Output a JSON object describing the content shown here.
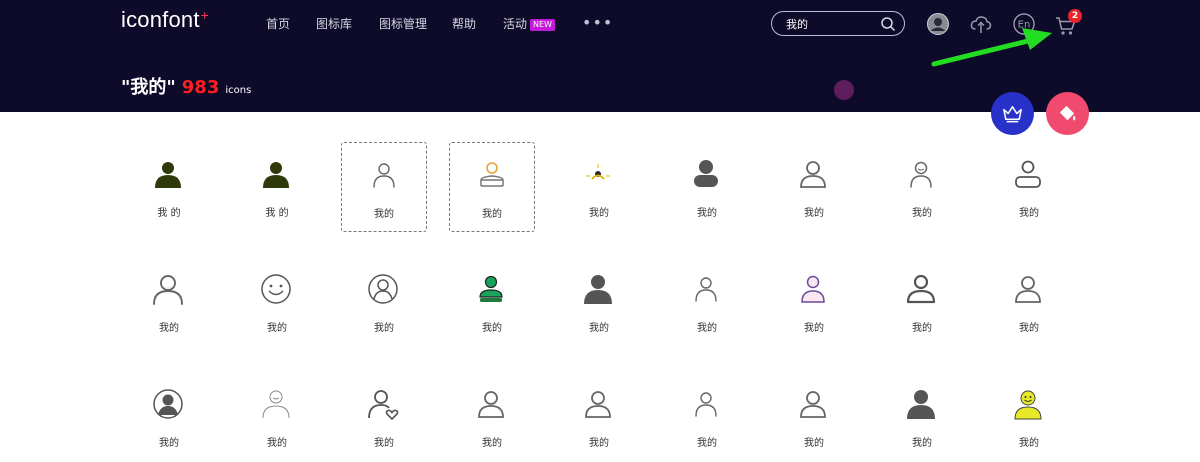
{
  "header": {
    "logo": "iconfont",
    "logo_mark": "+",
    "nav": [
      {
        "label": "首页"
      },
      {
        "label": "图标库"
      },
      {
        "label": "图标管理"
      },
      {
        "label": "帮助"
      },
      {
        "label": "活动",
        "badge": "NEW"
      }
    ],
    "more_label": "•••",
    "search": {
      "value": "我的"
    },
    "language_label": "En",
    "cart_count": "2",
    "icons": [
      "user-avatar-icon",
      "upload-cloud-icon",
      "language-icon",
      "cart-icon",
      "search-icon"
    ]
  },
  "page": {
    "query": "\"我的\"",
    "count": "983",
    "count_unit": "icons"
  },
  "fabs": [
    {
      "icon": "crown-icon",
      "color": "#2832c8"
    },
    {
      "icon": "paint-bucket-icon",
      "color": "#f04b6e"
    }
  ],
  "colors": {
    "header_bg": "#0e0a2a",
    "accent_red": "#ff1e1e",
    "arrow_green": "#22dd22"
  },
  "icons": [
    {
      "label": "我 的",
      "style": "solid-dark-olive",
      "selected": false
    },
    {
      "label": "我 的",
      "style": "solid-dark-olive",
      "selected": false
    },
    {
      "label": "我的",
      "style": "outline-thin-grey",
      "selected": true
    },
    {
      "label": "我的",
      "style": "outline-orange-head",
      "selected": true
    },
    {
      "label": "我的",
      "style": "sun-yellow",
      "selected": false
    },
    {
      "label": "我的",
      "style": "solid-grey-rounded",
      "selected": false
    },
    {
      "label": "我的",
      "style": "outline-grey",
      "selected": false
    },
    {
      "label": "我的",
      "style": "outline-face-grey",
      "selected": false
    },
    {
      "label": "我的",
      "style": "outline-block-grey",
      "selected": false
    },
    {
      "label": "我的",
      "style": "outline-large-grey",
      "selected": false
    },
    {
      "label": "我的",
      "style": "smiley-outline",
      "selected": false
    },
    {
      "label": "我的",
      "style": "circle-person-outline",
      "selected": false
    },
    {
      "label": "我的",
      "style": "green-person",
      "selected": false
    },
    {
      "label": "我的",
      "style": "solid-grey-large",
      "selected": false
    },
    {
      "label": "我的",
      "style": "outline-thin-grey",
      "selected": false
    },
    {
      "label": "我的",
      "style": "purple-person",
      "selected": false
    },
    {
      "label": "我的",
      "style": "outline-bold-grey",
      "selected": false
    },
    {
      "label": "我的",
      "style": "outline-grey",
      "selected": false
    },
    {
      "label": "我的",
      "style": "circle-solid-person",
      "selected": false
    },
    {
      "label": "我的",
      "style": "face-thin-outline",
      "selected": false
    },
    {
      "label": "我的",
      "style": "person-heart",
      "selected": false
    },
    {
      "label": "我的",
      "style": "outline-grey",
      "selected": false
    },
    {
      "label": "我的",
      "style": "outline-grey",
      "selected": false
    },
    {
      "label": "我的",
      "style": "outline-thin-grey",
      "selected": false
    },
    {
      "label": "我的",
      "style": "outline-grey",
      "selected": false
    },
    {
      "label": "我的",
      "style": "solid-grey-large",
      "selected": false
    },
    {
      "label": "我的",
      "style": "yellow-smiley-person",
      "selected": false
    }
  ]
}
